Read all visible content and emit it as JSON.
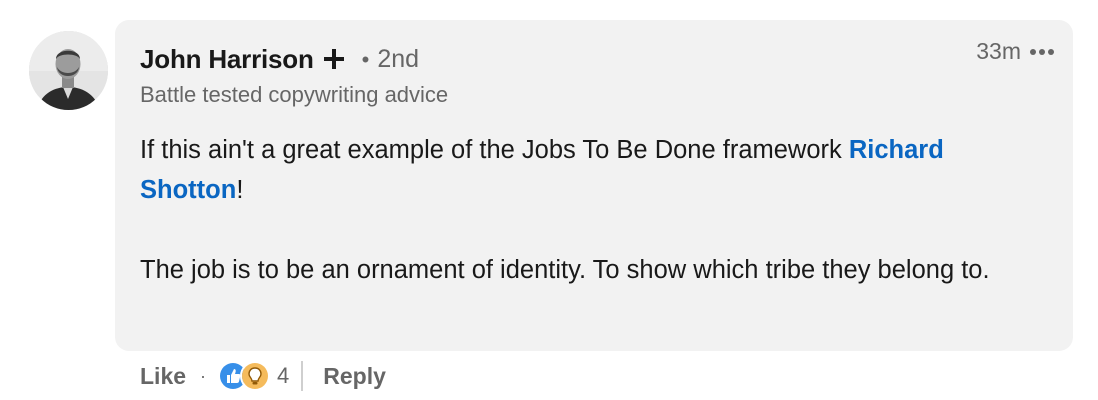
{
  "author": {
    "name": "John Harrison",
    "degree_dot": "•",
    "degree": "2nd",
    "headline": "Battle tested copywriting advice"
  },
  "meta": {
    "timestamp": "33m"
  },
  "body": {
    "line1_prefix": "If this ain't a great example of the Jobs To Be Done framework ",
    "mention": "Richard Shotton",
    "line1_suffix": "!",
    "paragraph2": "The job is to be an ornament of identity. To show which tribe they belong to."
  },
  "actions": {
    "like_label": "Like",
    "separator": "·",
    "reaction_count": "4",
    "reply_label": "Reply"
  },
  "icons": {
    "follow": "plus-icon",
    "more": "more-options-icon",
    "reaction_like": "like-reaction-icon",
    "reaction_insightful": "insightful-reaction-icon"
  },
  "colors": {
    "bubble": "#f2f2f2",
    "link": "#0a66c2",
    "text": "#191919",
    "secondary": "#666666",
    "like_blue": "#378fe9",
    "insight_yellow": "#f5bb5c"
  }
}
